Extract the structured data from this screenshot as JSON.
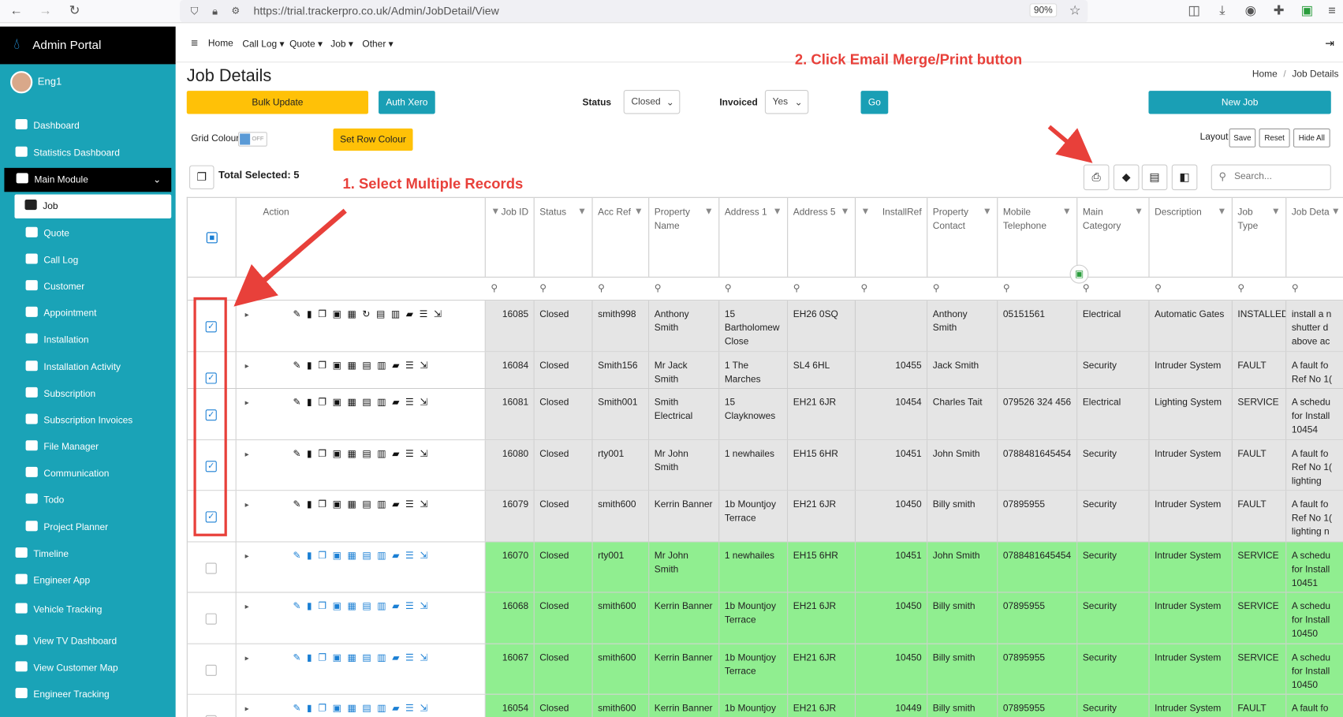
{
  "browser": {
    "url": "https://trial.trackerpro.co.uk/Admin/JobDetail/View",
    "zoom": "90%"
  },
  "brand": {
    "title": "Admin Portal",
    "user": "Eng1"
  },
  "sidebar": {
    "items": [
      {
        "label": "Dashboard",
        "icon": "dashboard-icon"
      },
      {
        "label": "Statistics Dashboard",
        "icon": "chart-icon"
      },
      {
        "label": "Main Module",
        "icon": "module-icon"
      },
      {
        "label": "Job",
        "icon": "wrench-icon"
      },
      {
        "label": "Quote",
        "icon": "calculator-icon"
      },
      {
        "label": "Call Log",
        "icon": "phone-icon"
      },
      {
        "label": "Customer",
        "icon": "users-icon"
      },
      {
        "label": "Appointment",
        "icon": "calendar-icon"
      },
      {
        "label": "Installation",
        "icon": "home-icon"
      },
      {
        "label": "Installation Activity",
        "icon": "chart-icon"
      },
      {
        "label": "Subscription",
        "icon": "file-icon"
      },
      {
        "label": "Subscription Invoices",
        "icon": "file-icon"
      },
      {
        "label": "File Manager",
        "icon": "folder-icon"
      },
      {
        "label": "Communication",
        "icon": "envelope-icon"
      },
      {
        "label": "Todo",
        "icon": "list-icon"
      },
      {
        "label": "Project Planner",
        "icon": "sitemap-icon"
      },
      {
        "label": "Timeline",
        "icon": "calendar-icon"
      },
      {
        "label": "Engineer App",
        "icon": "user-cog-icon"
      },
      {
        "label": "Vehicle Tracking",
        "icon": "person-pin-icon"
      },
      {
        "label": "View TV Dashboard",
        "icon": "monitor-icon"
      },
      {
        "label": "View Customer Map",
        "icon": "map-users-icon"
      },
      {
        "label": "Engineer Tracking",
        "icon": "location-icon"
      }
    ]
  },
  "topnav": {
    "items": [
      "Home",
      "Call Log",
      "Quote",
      "Job",
      "Other"
    ]
  },
  "page": {
    "title": "Job Details",
    "breadcrumb_home": "Home",
    "breadcrumb_sep": "/",
    "breadcrumb_current": "Job Details"
  },
  "hints": {
    "step1": "1. Select Multiple Records",
    "step2": "2. Click Email Merge/Print button"
  },
  "toolbar": {
    "bulk_update": "Bulk Update",
    "auth_xero": "Auth Xero",
    "status_label": "Status",
    "status_value": "Closed",
    "invoiced_label": "Invoiced",
    "invoiced_value": "Yes",
    "go": "Go",
    "new_job": "New Job",
    "grid_colour": "Grid Colour",
    "toggle": "OFF",
    "set_row_colour": "Set Row Colour",
    "layout": "Layout",
    "save": "Save",
    "reset": "Reset",
    "hide_all": "Hide All",
    "total_selected": "Total Selected: 5",
    "search_placeholder": "Search..."
  },
  "grid": {
    "action_header": "Action",
    "columns": [
      "Job ID",
      "Status",
      "Acc Ref",
      "Property Name",
      "Address 1",
      "Address 5",
      "InstallRef",
      "Property Contact",
      "Mobile Telephone",
      "Main Category",
      "Description",
      "Job Type",
      "Job Deta"
    ],
    "rows": [
      {
        "checked": true,
        "bg": "grey",
        "cells": [
          "16085",
          "Closed",
          "smith998",
          "Anthony Smith",
          "15 Bartholomew Close",
          "EH26 0SQ",
          "",
          "Anthony Smith",
          "05151561",
          "Electrical",
          "Automatic Gates",
          "INSTALLED",
          "install a n shutter d above ac"
        ]
      },
      {
        "checked": true,
        "bg": "grey",
        "cells": [
          "16084",
          "Closed",
          "Smith156",
          "Mr Jack Smith",
          "1 The Marches",
          "SL4 6HL",
          "10455",
          "Jack Smith",
          "",
          "Security",
          "Intruder System",
          "FAULT",
          "A fault fo Ref No 1("
        ]
      },
      {
        "checked": true,
        "bg": "grey",
        "cells": [
          "16081",
          "Closed",
          "Smith001",
          "Smith Electrical",
          "15 Clayknowes",
          "EH21 6JR",
          "10454",
          "Charles Tait",
          "079526 324 456",
          "Electrical",
          "Lighting System",
          "SERVICE",
          "A schedu for Install 10454"
        ]
      },
      {
        "checked": true,
        "bg": "grey",
        "cells": [
          "16080",
          "Closed",
          "rty001",
          "Mr John Smith",
          "1 newhailes",
          "EH15 6HR",
          "10451",
          "John Smith",
          "0788481645454",
          "Security",
          "Intruder System",
          "FAULT",
          "A fault fo Ref No 1( lighting"
        ]
      },
      {
        "checked": true,
        "bg": "grey",
        "cells": [
          "16079",
          "Closed",
          "smith600",
          "Kerrin Banner",
          "1b Mountjoy Terrace",
          "EH21 6JR",
          "10450",
          "Billy smith",
          "07895955",
          "Security",
          "Intruder System",
          "FAULT",
          "A fault fo Ref No 1( lighting n"
        ]
      },
      {
        "checked": false,
        "bg": "green",
        "cells": [
          "16070",
          "Closed",
          "rty001",
          "Mr John Smith",
          "1 newhailes",
          "EH15 6HR",
          "10451",
          "John Smith",
          "0788481645454",
          "Security",
          "Intruder System",
          "SERVICE",
          "A schedu for Install 10451"
        ]
      },
      {
        "checked": false,
        "bg": "green",
        "cells": [
          "16068",
          "Closed",
          "smith600",
          "Kerrin Banner",
          "1b Mountjoy Terrace",
          "EH21 6JR",
          "10450",
          "Billy smith",
          "07895955",
          "Security",
          "Intruder System",
          "SERVICE",
          "A schedu for Install 10450"
        ]
      },
      {
        "checked": false,
        "bg": "green",
        "cells": [
          "16067",
          "Closed",
          "smith600",
          "Kerrin Banner",
          "1b Mountjoy Terrace",
          "EH21 6JR",
          "10450",
          "Billy smith",
          "07895955",
          "Security",
          "Intruder System",
          "SERVICE",
          "A schedu for Install 10450"
        ]
      },
      {
        "checked": false,
        "bg": "green",
        "cells": [
          "16054",
          "Closed",
          "smith600",
          "Kerrin Banner",
          "1b Mountjoy",
          "EH21 6JR",
          "10449",
          "Billy smith",
          "07895955",
          "Security",
          "Intruder System",
          "FAULT",
          "A fault fo"
        ]
      }
    ]
  },
  "colors": {
    "sidebar": "#1aa3b7",
    "accent": "#ffc107",
    "teal": "#1a9fb5",
    "selected_row": "#e5e5e5",
    "closed_row": "#90ee90",
    "annotation": "#e8403a"
  }
}
